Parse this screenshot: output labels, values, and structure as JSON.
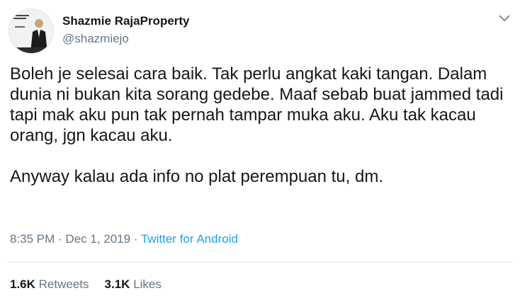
{
  "author": {
    "display_name": "Shazmie RajaProperty",
    "handle": "@shazmiejo",
    "avatar_icon": "profile-photo"
  },
  "tweet": {
    "paragraphs": [
      "Boleh je selesai cara baik. Tak perlu angkat kaki tangan. Dalam dunia ni bukan kita sorang gedebe. Maaf sebab buat jammed tadi tapi mak aku pun tak pernah tampar muka aku. Aku tak kacau orang, jgn kacau aku.",
      "Anyway kalau ada info no plat perempuan tu, dm."
    ],
    "time": "8:35 PM",
    "date": "Dec 1, 2019",
    "separator": " · ",
    "source": "Twitter for Android"
  },
  "stats": {
    "retweets_count": "1.6K",
    "retweets_label": "Retweets",
    "likes_count": "3.1K",
    "likes_label": "Likes"
  },
  "menu": {
    "icon": "chevron-down-icon"
  },
  "colors": {
    "text": "#14171a",
    "secondary": "#657786",
    "link": "#1da1f2",
    "divider": "#e1e8ed"
  }
}
